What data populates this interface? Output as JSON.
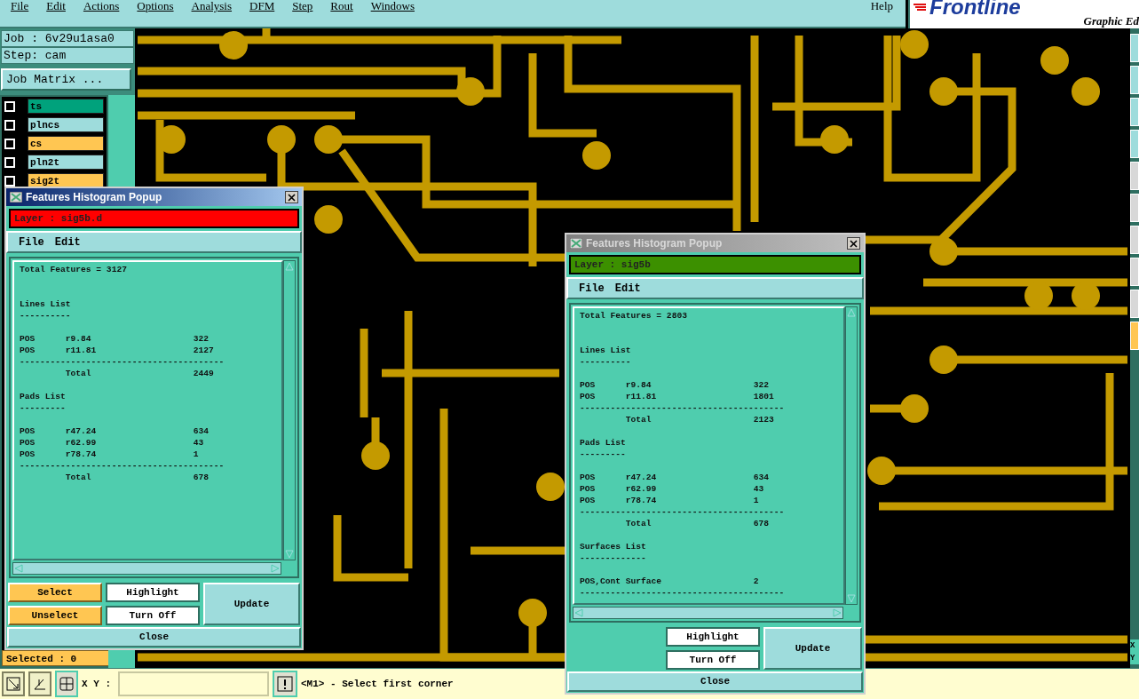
{
  "menu": {
    "items": [
      "File",
      "Edit",
      "Actions",
      "Options",
      "Analysis",
      "DFM",
      "Step",
      "Rout",
      "Windows"
    ],
    "help": "Help"
  },
  "logo": {
    "name": "Frontline",
    "subtitle": "Graphic Ed"
  },
  "left_panel": {
    "job": "Job :  6v29u1asa0",
    "step": "Step: cam",
    "job_matrix": "Job Matrix ...",
    "layers": [
      {
        "name": "ts",
        "color": "#00a27c",
        "checked": false
      },
      {
        "name": "plncs",
        "color": "#9edcdc",
        "checked": false
      },
      {
        "name": "cs",
        "color": "#ffc652",
        "checked": false
      },
      {
        "name": "pln2t",
        "color": "#9edcdc",
        "checked": false
      },
      {
        "name": "sig2t",
        "color": "#ffc652",
        "checked": false
      }
    ],
    "selected": "Selected : 0"
  },
  "popups": [
    {
      "title": "Features Histogram Popup",
      "active": true,
      "layer": "Layer :  sig5b.d",
      "layer_mismatch": true,
      "menu": [
        "File",
        "Edit"
      ],
      "lines": [
        {
          "kind": "text",
          "text": "Total Features = 3127"
        },
        {
          "kind": "blank"
        },
        {
          "kind": "blank"
        },
        {
          "kind": "text",
          "text": "Lines List"
        },
        {
          "kind": "text",
          "text": "----------"
        },
        {
          "kind": "blank"
        },
        {
          "kind": "text",
          "text": "POS      r9.84                    322"
        },
        {
          "kind": "text",
          "text": "POS      r11.81                   2127"
        },
        {
          "kind": "text",
          "text": "----------------------------------------"
        },
        {
          "kind": "text",
          "text": "         Total                    2449"
        },
        {
          "kind": "blank"
        },
        {
          "kind": "text",
          "text": "Pads List"
        },
        {
          "kind": "text",
          "text": "---------"
        },
        {
          "kind": "blank"
        },
        {
          "kind": "text",
          "text": "POS      r47.24                   634"
        },
        {
          "kind": "text",
          "text": "POS      r62.99                   43"
        },
        {
          "kind": "text",
          "text": "POS      r78.74                   1"
        },
        {
          "kind": "text",
          "text": "----------------------------------------"
        },
        {
          "kind": "text",
          "text": "         Total                    678"
        }
      ],
      "buttons": [
        {
          "label": "Select",
          "kind": "select"
        },
        {
          "label": "Highlight",
          "kind": "plain"
        },
        {
          "label": "Unselect",
          "kind": "select"
        },
        {
          "label": "Turn Off",
          "kind": "plain"
        }
      ],
      "update": "Update",
      "close": "Close"
    },
    {
      "title": "Features Histogram Popup",
      "active": false,
      "layer": "Layer :  sig5b",
      "layer_mismatch": false,
      "menu": [
        "File",
        "Edit"
      ],
      "lines": [
        {
          "kind": "text",
          "text": "Total Features = 2803"
        },
        {
          "kind": "blank"
        },
        {
          "kind": "blank"
        },
        {
          "kind": "text",
          "text": "Lines List"
        },
        {
          "kind": "text",
          "text": "----------"
        },
        {
          "kind": "blank"
        },
        {
          "kind": "text",
          "text": "POS      r9.84                    322"
        },
        {
          "kind": "text",
          "text": "POS      r11.81                   1801"
        },
        {
          "kind": "text",
          "text": "----------------------------------------"
        },
        {
          "kind": "text",
          "text": "         Total                    2123"
        },
        {
          "kind": "blank"
        },
        {
          "kind": "text",
          "text": "Pads List"
        },
        {
          "kind": "text",
          "text": "---------"
        },
        {
          "kind": "blank"
        },
        {
          "kind": "text",
          "text": "POS      r47.24                   634"
        },
        {
          "kind": "text",
          "text": "POS      r62.99                   43"
        },
        {
          "kind": "text",
          "text": "POS      r78.74                   1"
        },
        {
          "kind": "text",
          "text": "----------------------------------------"
        },
        {
          "kind": "text",
          "text": "         Total                    678"
        },
        {
          "kind": "blank"
        },
        {
          "kind": "text",
          "text": "Surfaces List"
        },
        {
          "kind": "text",
          "text": "-------------"
        },
        {
          "kind": "blank"
        },
        {
          "kind": "text",
          "text": "POS,Cont Surface                  2"
        },
        {
          "kind": "text",
          "text": "----------------------------------------"
        }
      ],
      "buttons": [
        {
          "label": "Highlight",
          "kind": "plain"
        },
        {
          "label": "Turn Off",
          "kind": "plain"
        }
      ],
      "update": "Update",
      "close": "Close"
    }
  ],
  "status_bar": {
    "xy_label": "X Y :",
    "message": "<M1> - Select first corner"
  },
  "right_strip": {
    "labels": [
      "X",
      "Y"
    ]
  }
}
